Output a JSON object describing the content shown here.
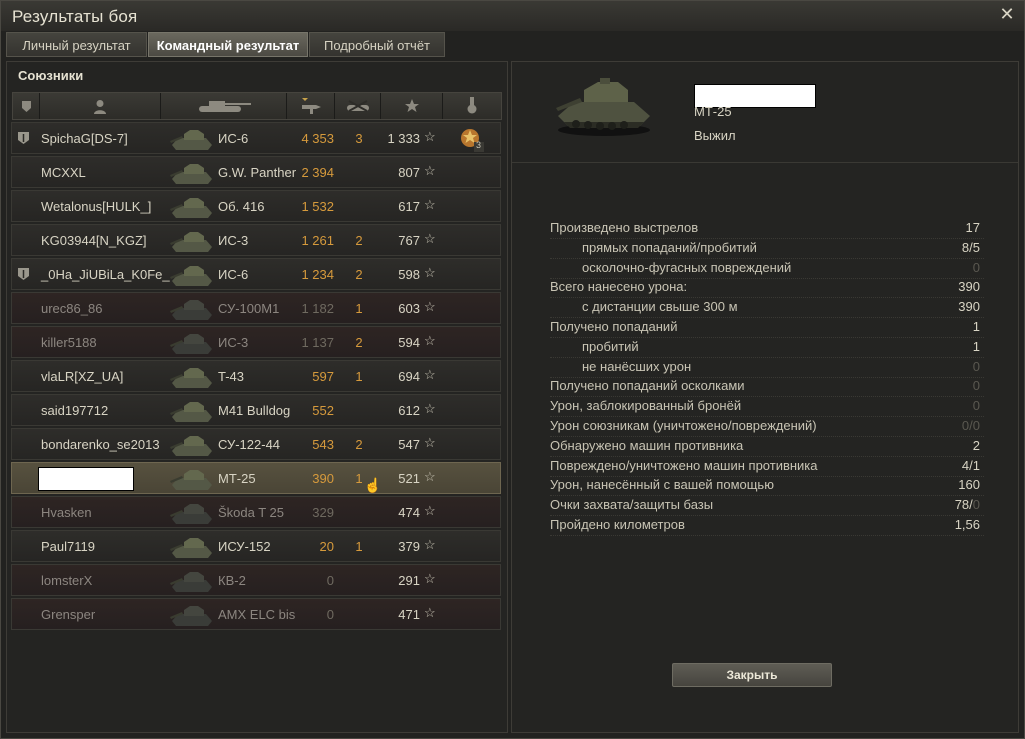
{
  "window": {
    "title": "Результаты боя",
    "close_icon": "close-icon"
  },
  "tabs": [
    {
      "label": "Личный результат",
      "active": false
    },
    {
      "label": "Командный результат",
      "active": true
    },
    {
      "label": "Подробный отчёт",
      "active": false
    }
  ],
  "team": {
    "title": "Союзники",
    "columns": [
      "rank-icon",
      "player-icon",
      "tank-icon",
      "damage-icon",
      "kills-icon",
      "xp-icon",
      "medal-icon"
    ],
    "rows": [
      {
        "rank": true,
        "player": "SpichaG[DS-7]",
        "tank": "ИС-6",
        "damage": "4 353",
        "kills": "3",
        "xp": "1 333",
        "dead": false,
        "medal": true,
        "medal_count": "3"
      },
      {
        "rank": false,
        "player": "MCXXL",
        "tank": "G.W. Panther",
        "damage": "2 394",
        "kills": "",
        "xp": "807",
        "dead": false
      },
      {
        "rank": false,
        "player": "Wetalonus[HULK_]",
        "tank": "Об. 416",
        "damage": "1 532",
        "kills": "",
        "xp": "617",
        "dead": false
      },
      {
        "rank": false,
        "player": "KG03944[N_KGZ]",
        "tank": "ИС-3",
        "damage": "1 261",
        "kills": "2",
        "xp": "767",
        "dead": false
      },
      {
        "rank": true,
        "player": "_0Ha_JiUBiLa_K0Fe_",
        "tank": "ИС-6",
        "damage": "1 234",
        "kills": "2",
        "xp": "598",
        "dead": false
      },
      {
        "rank": false,
        "player": "urec86_86",
        "tank": "СУ-100М1",
        "damage": "1 182",
        "kills": "1",
        "xp": "603",
        "dead": true
      },
      {
        "rank": false,
        "player": "killer5188",
        "tank": "ИС-3",
        "damage": "1 137",
        "kills": "2",
        "xp": "594",
        "dead": true
      },
      {
        "rank": false,
        "player": "vlaLR[XZ_UA]",
        "tank": "T-43",
        "damage": "597",
        "kills": "1",
        "xp": "694",
        "dead": false
      },
      {
        "rank": false,
        "player": "said197712",
        "tank": "M41 Bulldog",
        "damage": "552",
        "kills": "",
        "xp": "612",
        "dead": false
      },
      {
        "rank": false,
        "player": "bondarenko_se2013",
        "tank": "СУ-122-44",
        "damage": "543",
        "kills": "2",
        "xp": "547",
        "dead": false
      },
      {
        "rank": false,
        "player": "",
        "tank": "МТ-25",
        "damage": "390",
        "kills": "1",
        "xp": "521",
        "dead": false,
        "me": true
      },
      {
        "rank": false,
        "player": "Hvasken",
        "tank": "Škoda T 25",
        "damage": "329",
        "kills": "",
        "xp": "474",
        "dead": true
      },
      {
        "rank": false,
        "player": "Paul7119",
        "tank": "ИСУ-152",
        "damage": "20",
        "kills": "1",
        "xp": "379",
        "dead": false
      },
      {
        "rank": false,
        "player": "lomsterX",
        "tank": "КВ-2",
        "damage": "0",
        "kills": "",
        "xp": "291",
        "dead": true
      },
      {
        "rank": false,
        "player": "Grensper",
        "tank": "AMX ELC bis",
        "damage": "0",
        "kills": "",
        "xp": "471",
        "dead": true
      }
    ]
  },
  "vehicle": {
    "name": "МТ-25",
    "status": "Выжил"
  },
  "stats": [
    {
      "label": "Произведено выстрелов",
      "value": "17",
      "indent": false
    },
    {
      "label": "прямых попаданий/пробитий",
      "value": "8/5",
      "indent": true
    },
    {
      "label": "осколочно-фугасных повреждений",
      "value": "0",
      "indent": true,
      "dim": true
    },
    {
      "label": "Всего нанесено урона:",
      "value": "390",
      "indent": false
    },
    {
      "label": "с дистанции свыше 300 м",
      "value": "390",
      "indent": true
    },
    {
      "label": "Получено попаданий",
      "value": "1",
      "indent": false
    },
    {
      "label": "пробитий",
      "value": "1",
      "indent": true
    },
    {
      "label": "не нанёсших урон",
      "value": "0",
      "indent": true,
      "dim": true
    },
    {
      "label": "Получено попаданий осколками",
      "value": "0",
      "indent": false,
      "dim": true
    },
    {
      "label": "Урон, заблокированный бронёй",
      "value": "0",
      "indent": false,
      "dim": true
    },
    {
      "label": "Урон союзникам (уничтожено/повреждений)",
      "value": "0/0",
      "indent": false,
      "dim": true
    },
    {
      "label": "Обнаружено машин противника",
      "value": "2",
      "indent": false
    },
    {
      "label": "Повреждено/уничтожено машин противника",
      "value": "4/1",
      "indent": false
    },
    {
      "label": "Урон, нанесённый с вашей помощью",
      "value": "160",
      "indent": false
    },
    {
      "label": "Очки захвата/защиты базы",
      "value": "78/",
      "value_dim": "0",
      "indent": false
    },
    {
      "label": "Пройдено километров",
      "value": "1,56",
      "indent": false
    }
  ],
  "close_button": "Закрыть",
  "colors": {
    "accent": "#d69a3c",
    "dead_row": "#2e2523",
    "me_row": "#57513f"
  }
}
